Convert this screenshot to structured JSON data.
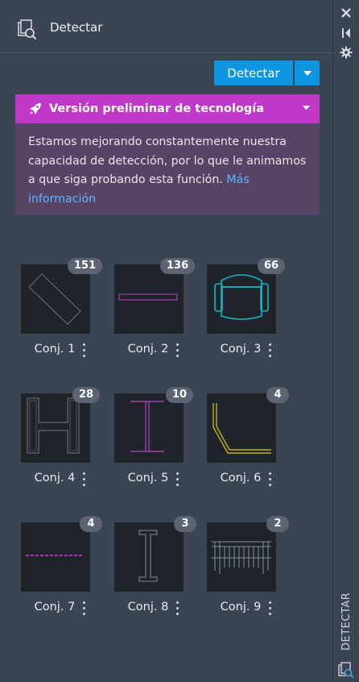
{
  "header": {
    "title": "Detectar",
    "icon": "detect-panel-icon"
  },
  "toolbar": {
    "detect_label": "Detectar",
    "dropdown_icon": "chevron-down-icon",
    "accent": "#0e96e2"
  },
  "preview_banner": {
    "title": "Versión preliminar de tecnología",
    "body": "Estamos mejorando constantemente nuestra capacidad de detección, por lo que le animamos a que siga probando esta función.",
    "link": "Más información",
    "bar_color": "#c138c8",
    "body_color": "#574363"
  },
  "sets": [
    {
      "label": "Conj. 1",
      "count": "151",
      "shape": "rotated-rectangle"
    },
    {
      "label": "Conj. 2",
      "count": "136",
      "shape": "horizontal-bar"
    },
    {
      "label": "Conj. 3",
      "count": "66",
      "shape": "chair"
    },
    {
      "label": "Conj. 4",
      "count": "28",
      "shape": "h-beam"
    },
    {
      "label": "Conj. 5",
      "count": "10",
      "shape": "i-beam"
    },
    {
      "label": "Conj. 6",
      "count": "4",
      "shape": "l-corner"
    },
    {
      "label": "Conj. 7",
      "count": "4",
      "shape": "dashed-line"
    },
    {
      "label": "Conj. 8",
      "count": "3",
      "shape": "i-column"
    },
    {
      "label": "Conj. 9",
      "count": "2",
      "shape": "railing"
    }
  ],
  "side_strip": {
    "tab_label": "DETECTAR",
    "icons": [
      "close-icon",
      "collapse-icon",
      "settings-icon"
    ]
  }
}
